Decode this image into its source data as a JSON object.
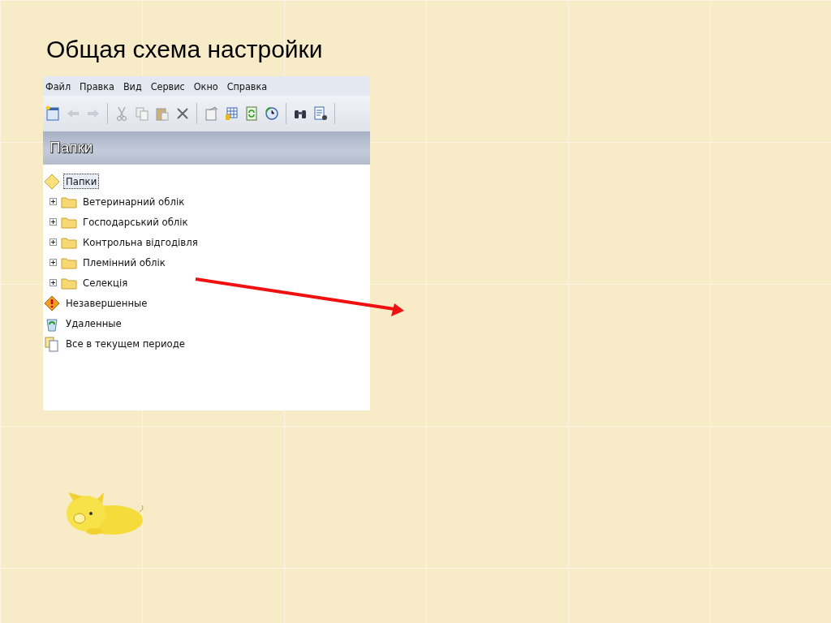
{
  "slide": {
    "title": "Общая схема настройки"
  },
  "window": {
    "menu": [
      "Файл",
      "Правка",
      "Вид",
      "Сервис",
      "Окно",
      "Справка"
    ],
    "panel_title": "Папки",
    "tree": [
      {
        "label": "Папки",
        "kind": "root",
        "selected": true
      },
      {
        "label": "Ветеринарний облік",
        "kind": "folder",
        "expanded": false,
        "selected": false
      },
      {
        "label": "Господарський облік",
        "kind": "folder",
        "expanded": false,
        "selected": false
      },
      {
        "label": "Контрольна відгодівля",
        "kind": "folder",
        "expanded": false,
        "selected": false
      },
      {
        "label": "Племінний облік",
        "kind": "folder",
        "expanded": false,
        "selected": false
      },
      {
        "label": "Селекція",
        "kind": "folder",
        "expanded": false,
        "selected": false
      },
      {
        "label": "Незавершенные",
        "kind": "warning",
        "selected": false
      },
      {
        "label": "Удаленные",
        "kind": "bin",
        "selected": false
      },
      {
        "label": "Все в текущем периоде",
        "kind": "documents",
        "selected": false
      }
    ]
  }
}
